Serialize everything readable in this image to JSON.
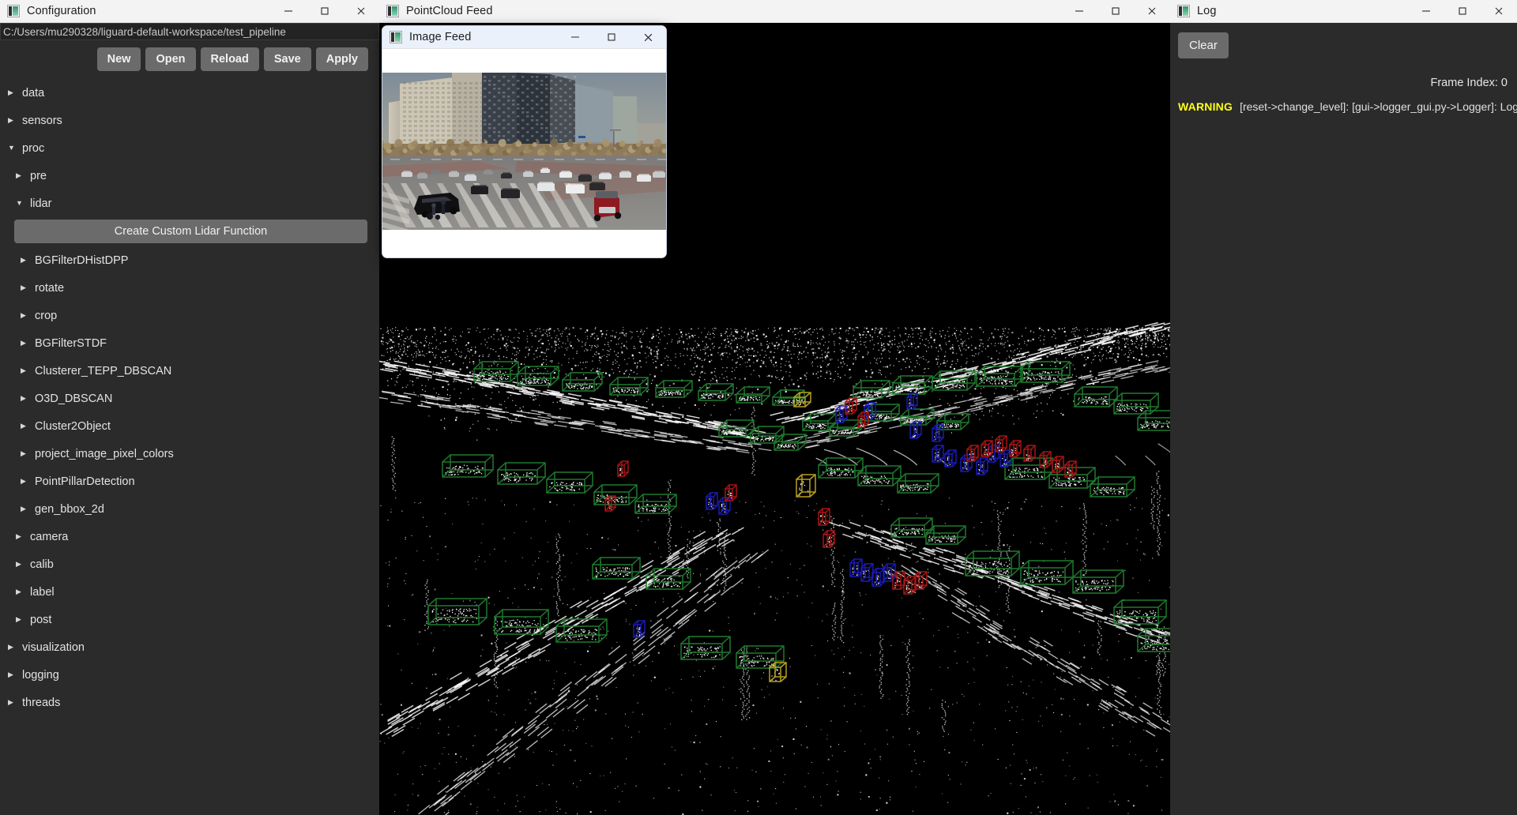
{
  "windows": {
    "config": {
      "title": "Configuration",
      "icon": "app-icon",
      "path_value": "C:/Users/mu290328/liguard-default-workspace/test_pipeline",
      "minimize": "minimize-icon",
      "maximize": "maximize-icon",
      "close": "close-icon",
      "buttons": [
        "New",
        "Open",
        "Reload",
        "Save",
        "Apply"
      ],
      "create_custom_lidar_function": "Create Custom Lidar Function",
      "tree": [
        {
          "label": "data",
          "level": 1,
          "expanded": false
        },
        {
          "label": "sensors",
          "level": 1,
          "expanded": false
        },
        {
          "label": "proc",
          "level": 1,
          "expanded": true
        },
        {
          "label": "pre",
          "level": 2,
          "expanded": false
        },
        {
          "label": "lidar",
          "level": 2,
          "expanded": true
        },
        {
          "label": "BGFilterDHistDPP",
          "level": 3,
          "expanded": false
        },
        {
          "label": "rotate",
          "level": 3,
          "expanded": false
        },
        {
          "label": "crop",
          "level": 3,
          "expanded": false
        },
        {
          "label": "BGFilterSTDF",
          "level": 3,
          "expanded": false
        },
        {
          "label": "Clusterer_TEPP_DBSCAN",
          "level": 3,
          "expanded": false
        },
        {
          "label": "O3D_DBSCAN",
          "level": 3,
          "expanded": false
        },
        {
          "label": "Cluster2Object",
          "level": 3,
          "expanded": false
        },
        {
          "label": "project_image_pixel_colors",
          "level": 3,
          "expanded": false
        },
        {
          "label": "PointPillarDetection",
          "level": 3,
          "expanded": false
        },
        {
          "label": "gen_bbox_2d",
          "level": 3,
          "expanded": false
        },
        {
          "label": "camera",
          "level": 2,
          "expanded": false
        },
        {
          "label": "calib",
          "level": 2,
          "expanded": false
        },
        {
          "label": "label",
          "level": 2,
          "expanded": false
        },
        {
          "label": "post",
          "level": 2,
          "expanded": false
        },
        {
          "label": "visualization",
          "level": 1,
          "expanded": false
        },
        {
          "label": "logging",
          "level": 1,
          "expanded": false
        },
        {
          "label": "threads",
          "level": 1,
          "expanded": false
        }
      ]
    },
    "pointcloud": {
      "title": "PointCloud Feed",
      "icon": "app-icon",
      "minimize": "minimize-icon",
      "maximize": "maximize-icon",
      "close": "close-icon"
    },
    "imagefeed": {
      "title": "Image Feed",
      "icon": "app-icon",
      "minimize": "minimize-icon",
      "maximize": "maximize-icon",
      "close": "close-icon",
      "scene_description": "urban road intersection with crosswalk, cars, high-rise buildings, pedestrians and red three-wheeler"
    },
    "log": {
      "title": "Log",
      "icon": "app-icon",
      "minimize": "minimize-icon",
      "maximize": "maximize-icon",
      "close": "close-icon",
      "clear_label": "Clear",
      "frame_index_label": "Frame Index: 0",
      "entries": [
        {
          "level": "WARNING",
          "message": "[reset->change_level]: [gui->logger_gui.py->Logger]: Logg"
        }
      ]
    }
  },
  "colors": {
    "window_chrome": "#f3f3f3",
    "window_chrome_active": "#eaf1fb",
    "panel_bg": "#2b2b2b",
    "panel_text": "#e3e3e3",
    "button_bg": "#6b6b6b",
    "path_bg": "#232323",
    "canvas_bg": "#000000",
    "warning": "#ffff1f",
    "bbox_vehicle": "#1f7a2e",
    "bbox_pedestrian": "#1a1ab4",
    "bbox_cyclist": "#a81414",
    "bbox_other": "#b8a01e",
    "point_color": "#ffffff"
  }
}
